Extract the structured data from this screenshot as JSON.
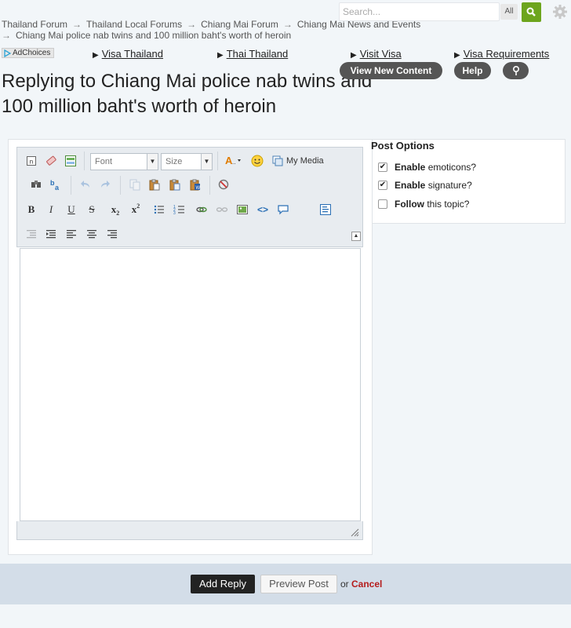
{
  "breadcrumb": {
    "items": [
      "Thailand Forum",
      "Thailand Local Forums",
      "Chiang Mai Forum",
      "Chiang Mai News and Events",
      "Chiang Mai police nab twins and 100 million baht's worth of heroin"
    ],
    "separator": "→"
  },
  "search": {
    "placeholder": "Search...",
    "scope_label": "All"
  },
  "ads": {
    "adchoices_label": "AdChoices",
    "links": [
      "Visa Thailand",
      "Thai Thailand",
      "Visit Visa",
      "Visa Requirements"
    ]
  },
  "page_title": "Replying to Chiang Mai police nab twins and 100 million baht's worth of heroin",
  "header_buttons": {
    "view_new_content": "View New Content",
    "help": "Help"
  },
  "editor": {
    "font_select": "Font",
    "size_select": "Size",
    "my_media_label": "My Media"
  },
  "post_options": {
    "title": "Post Options",
    "options": [
      {
        "bold": "Enable",
        "text": "emoticons?",
        "checked": true
      },
      {
        "bold": "Enable",
        "text": "signature?",
        "checked": true
      },
      {
        "bold": "Follow",
        "text": "this topic?",
        "checked": false
      }
    ]
  },
  "actions": {
    "add_reply": "Add Reply",
    "preview_post": "Preview Post",
    "or_text": "or",
    "cancel": "Cancel"
  },
  "colors": {
    "search_button": "#6da51d",
    "pill_bg": "#555555",
    "cancel": "#b51c1c",
    "bottom_bar": "#d3dde8"
  }
}
